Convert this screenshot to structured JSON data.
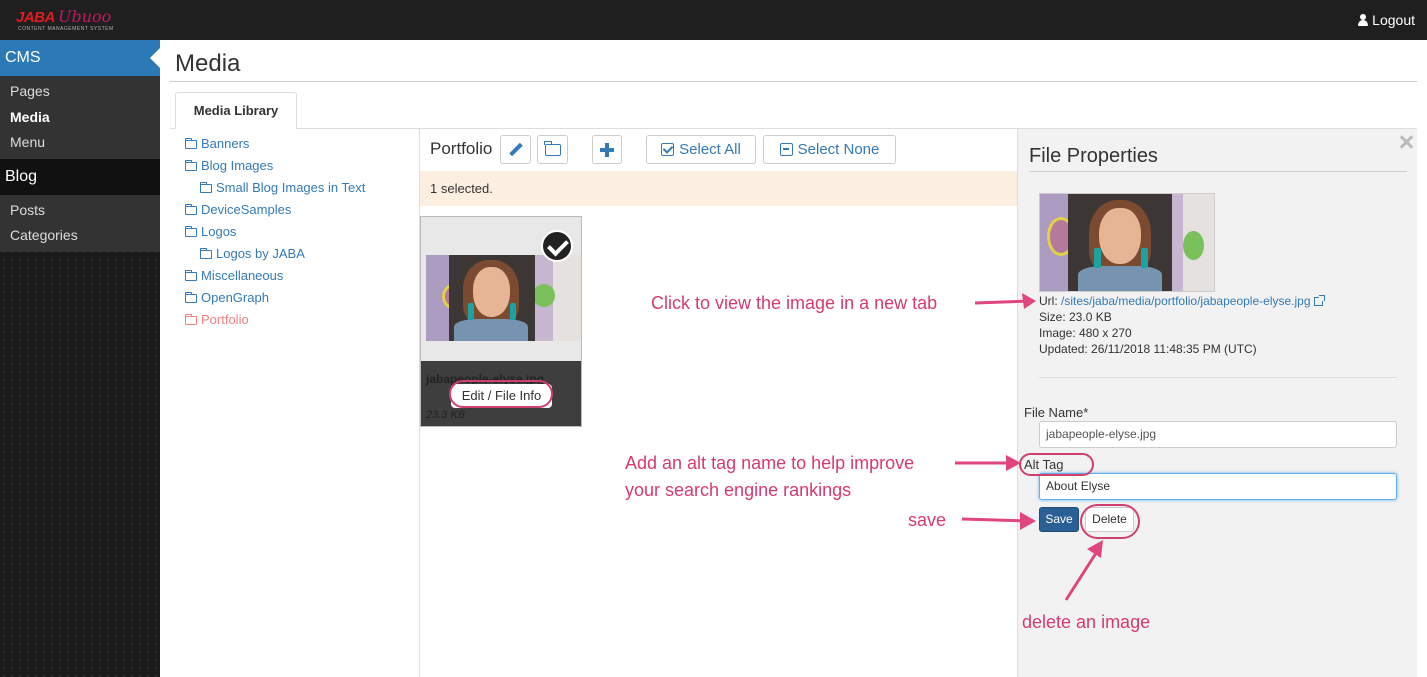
{
  "app": {
    "logo_main": "JABA",
    "logo_script": "Ubuoo",
    "logo_tagline": "CONTENT MANAGEMENT SYSTEM",
    "logout_label": "Logout"
  },
  "sidebar": {
    "sections": [
      {
        "label": "CMS",
        "items": [
          "Pages",
          "Media",
          "Menu"
        ]
      },
      {
        "label": "Blog",
        "items": [
          "Posts",
          "Categories"
        ]
      }
    ]
  },
  "page": {
    "title": "Media",
    "tab_label": "Media Library"
  },
  "folders": [
    {
      "label": "Banners"
    },
    {
      "label": "Blog Images"
    },
    {
      "label": "Small Blog Images in Text"
    },
    {
      "label": "DeviceSamples"
    },
    {
      "label": "Logos"
    },
    {
      "label": "Logos by JABA"
    },
    {
      "label": "Miscellaneous"
    },
    {
      "label": "OpenGraph"
    },
    {
      "label": "Portfolio"
    }
  ],
  "toolbar": {
    "folder_name": "Portfolio",
    "select_all_label": "Select All",
    "select_none_label": "Select None"
  },
  "selection_status": "1 selected.",
  "media_item": {
    "filename": "jabapeople-elyse.jpg",
    "edit_label": "Edit / File Info",
    "size": "23.3 KB"
  },
  "properties": {
    "title": "File Properties",
    "url_label": "Url:",
    "url_value": "/sites/jaba/media/portfolio/jabapeople-elyse.jpg",
    "size": "Size: 23.0 KB",
    "dimensions": "Image: 480 x 270",
    "updated": "Updated: 26/11/2018 11:48:35 PM (UTC)",
    "file_name_label": "File Name*",
    "file_name_value": "jabapeople-elyse.jpg",
    "alt_tag_label": "Alt Tag",
    "alt_tag_value": "About Elyse",
    "save_label": "Save",
    "delete_label": "Delete"
  },
  "annotations": {
    "view_image": "Click to view the image in a new tab",
    "alt_tag_line1": "Add an alt tag name to help improve",
    "alt_tag_line2": "your search engine rankings",
    "save": "save",
    "delete": "delete an image"
  },
  "colors": {
    "accent": "#2b7ab7",
    "link": "#337ab7",
    "annotation": "#d63a73",
    "topbar": "#1f1f1f",
    "alert_bg": "#fcefe1",
    "active_folder": "#f08080"
  },
  "icons": {
    "user": "user-icon",
    "edit": "pencil-icon",
    "folder": "folder-icon",
    "add": "plus-icon",
    "select_all": "check-square-icon",
    "select_none": "minus-square-icon",
    "selected": "checkmark-circle-icon",
    "close": "close-icon",
    "external": "external-link-icon"
  }
}
